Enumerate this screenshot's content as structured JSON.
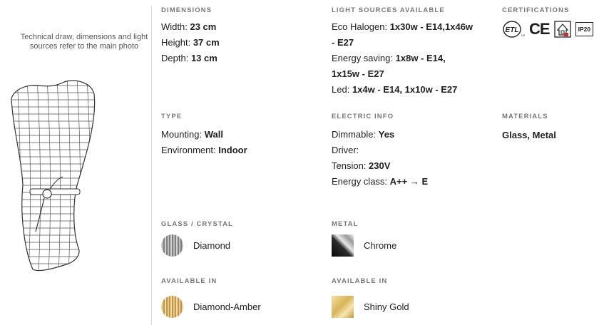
{
  "note": "Technical draw, dimensions and light sources refer to the main photo",
  "dimensions": {
    "heading": "DIMENSIONS",
    "width_label": "Width:",
    "width_value": "23 cm",
    "height_label": "Height:",
    "height_value": "37 cm",
    "depth_label": "Depth:",
    "depth_value": "13 cm"
  },
  "light_sources": {
    "heading": "LIGHT SOURCES AVAILABLE",
    "eco_label": "Eco Halogen:",
    "eco_value_1": "1x30w - E14,1x46w",
    "eco_value_2": "- E27",
    "energy_label": "Energy saving:",
    "energy_value_1": "1x8w - E14,",
    "energy_value_2": "1x15w - E27",
    "led_label": "Led:",
    "led_value": "1x4w - E14, 1x10w - E27"
  },
  "certifications": {
    "heading": "CERTIFICATIONS",
    "items": [
      {
        "icon": "etl-listed-icon",
        "text": "ETL"
      },
      {
        "icon": "ce-mark-icon",
        "text": "CE"
      },
      {
        "icon": "class-ii-icon",
        "text": ""
      },
      {
        "icon": "ip20-icon",
        "text": "IP20"
      }
    ]
  },
  "type": {
    "heading": "TYPE",
    "mounting_label": "Mounting:",
    "mounting_value": "Wall",
    "environment_label": "Environment:",
    "environment_value": "Indoor"
  },
  "electric": {
    "heading": "ELECTRIC INFO",
    "dimmable_label": "Dimmable:",
    "dimmable_value": "Yes",
    "driver_label": "Driver:",
    "tension_label": "Tension:",
    "tension_value": "230V",
    "energy_label": "Energy class:",
    "energy_value": "A++ → E"
  },
  "materials": {
    "heading": "MATERIALS",
    "value": "Glass, Metal"
  },
  "glass": {
    "heading": "GLASS / CRYSTAL",
    "name": "Diamond",
    "available_heading": "AVAILABLE IN",
    "available_name": "Diamond-Amber"
  },
  "metal": {
    "heading": "METAL",
    "name": "Chrome",
    "available_heading": "AVAILABLE IN",
    "available_name": "Shiny Gold"
  },
  "colors": {
    "heading": "#777777",
    "text": "#1f1f1f",
    "divider": "#d9d9d9"
  }
}
